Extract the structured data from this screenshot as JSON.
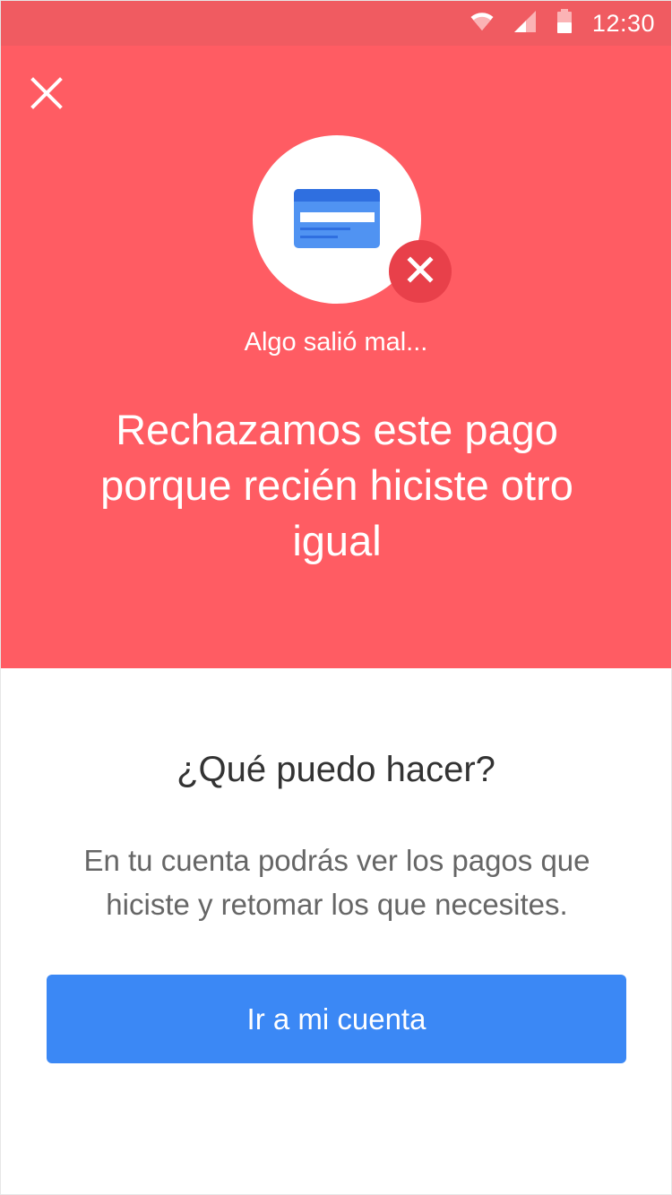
{
  "status_bar": {
    "time": "12:30",
    "icons": [
      "wifi-icon",
      "cell-signal-icon",
      "battery-icon"
    ]
  },
  "header": {
    "close_icon": "close-icon"
  },
  "illustration": {
    "icon": "credit-card-icon",
    "badge_icon": "error-x-icon"
  },
  "hero": {
    "subtitle": "Algo salió mal...",
    "headline": "Rechazamos este pago porque recién hiciste otro igual"
  },
  "help": {
    "title": "¿Qué puedo hacer?",
    "description": "En tu cuenta podrás ver los pagos que hiciste y retomar los que necesites."
  },
  "actions": {
    "primary_label": "Ir a mi cuenta"
  },
  "colors": {
    "status_bar": "#f05b61",
    "hero_background": "#ff5c63",
    "error_badge": "#e8404a",
    "card": "#5093f2",
    "card_stripe": "#2f6fe0",
    "primary_button": "#3b88f5"
  }
}
